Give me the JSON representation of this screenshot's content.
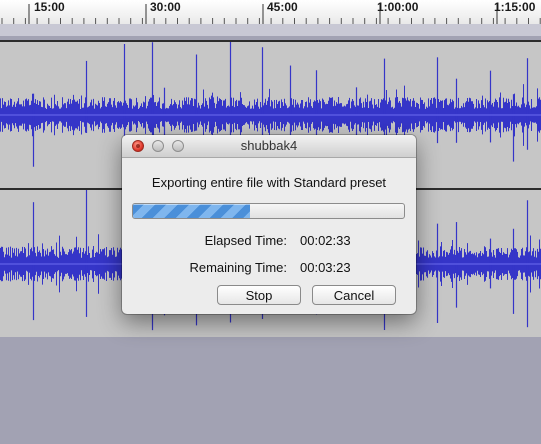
{
  "timeline": {
    "ticks": [
      "15:00",
      "30:00",
      "45:00",
      "1:00:00",
      "1:15:00"
    ]
  },
  "dialog": {
    "title": "shubbak4",
    "message": "Exporting entire file with Standard preset",
    "progress_fraction": 0.43,
    "elapsed_label": "Elapsed Time:",
    "elapsed_value": "00:02:33",
    "remaining_label": "Remaining Time:",
    "remaining_value": "00:03:23",
    "stop_label": "Stop",
    "cancel_label": "Cancel"
  },
  "colors": {
    "waveform": "#3535c8",
    "track_bg": "#c6c6c6",
    "progress": "#4a8fd9"
  }
}
